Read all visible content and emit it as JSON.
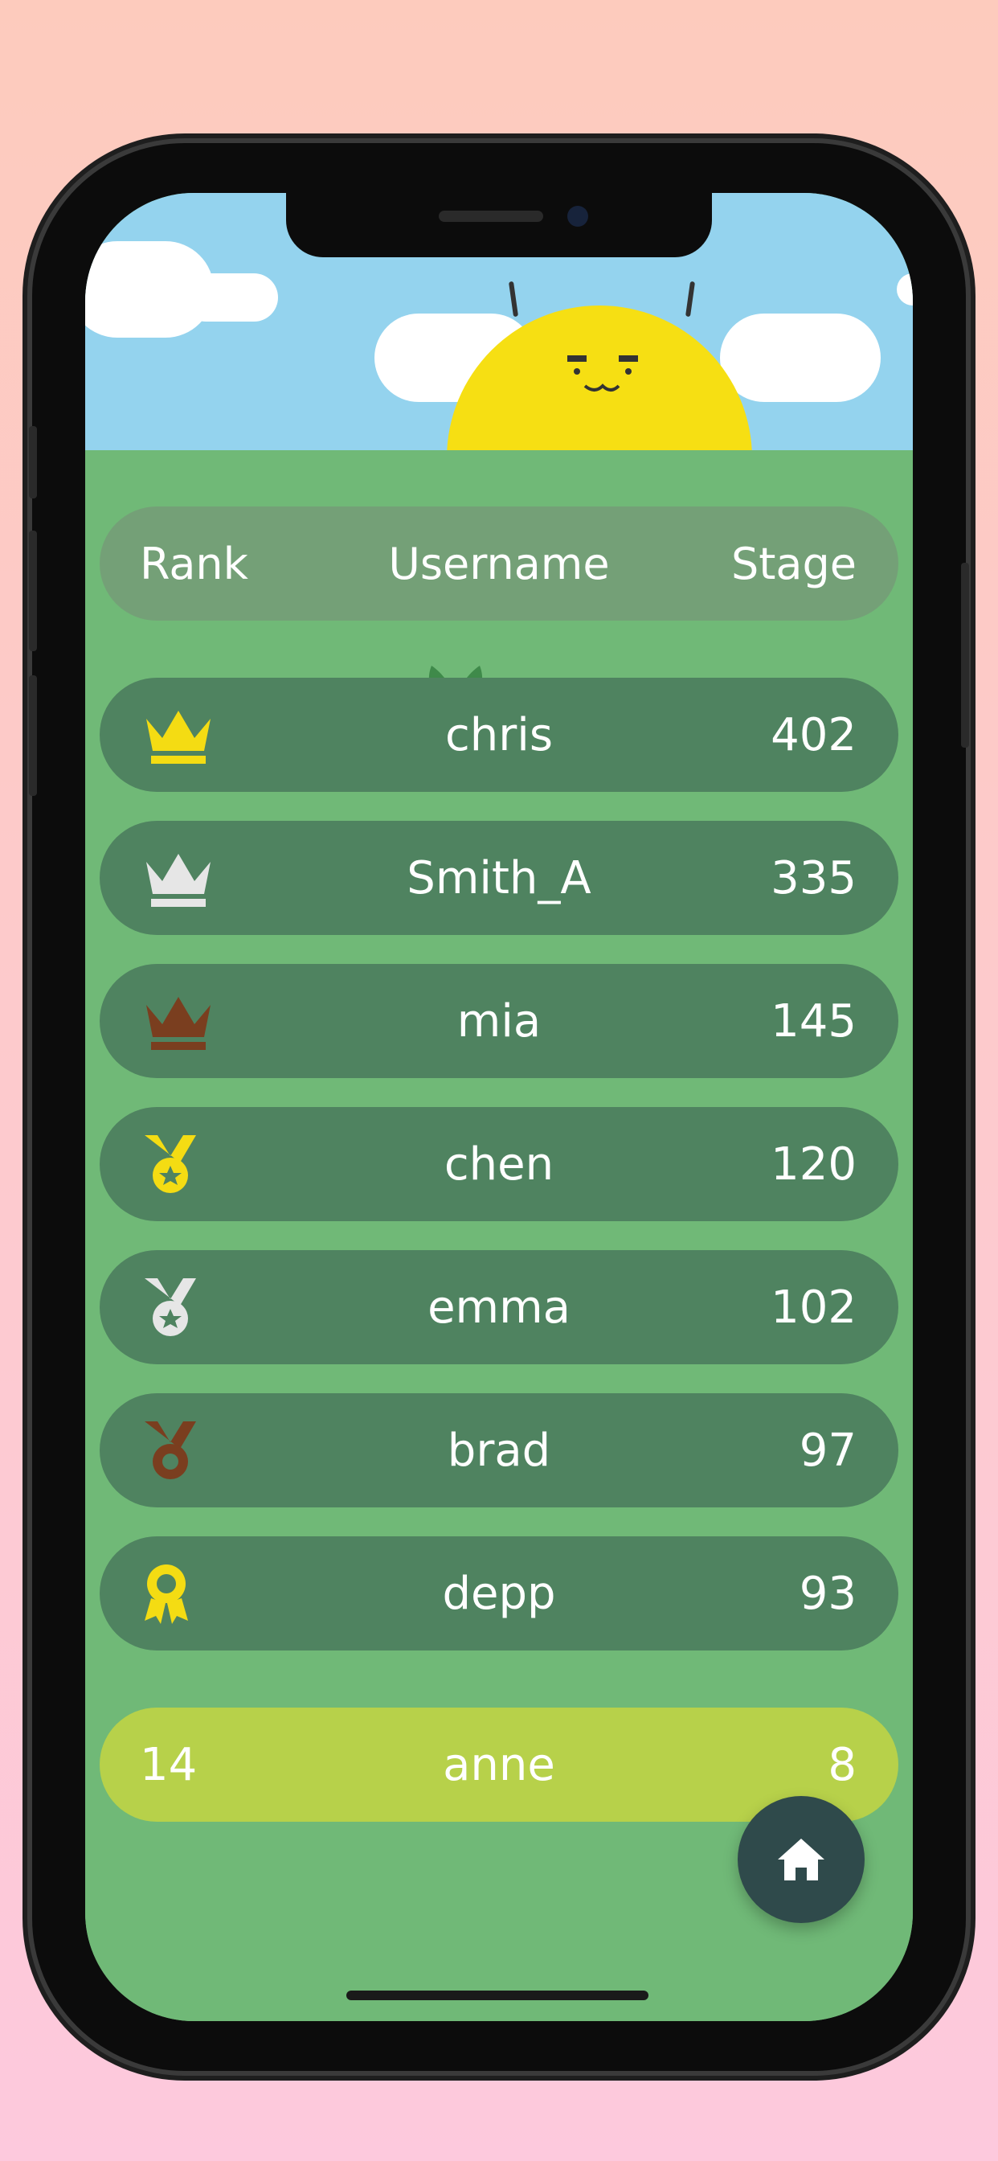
{
  "header": {
    "rank_label": "Rank",
    "username_label": "Username",
    "stage_label": "Stage"
  },
  "leaderboard": [
    {
      "rank_icon": "gold-crown-icon",
      "icon_color": "#f4dc13",
      "username": "chris",
      "stage": "402"
    },
    {
      "rank_icon": "silver-crown-icon",
      "icon_color": "#e6e6e6",
      "username": "Smith_A",
      "stage": "335"
    },
    {
      "rank_icon": "bronze-crown-icon",
      "icon_color": "#7a3e1f",
      "username": "mia",
      "stage": "145"
    },
    {
      "rank_icon": "gold-medal-icon",
      "icon_color": "#f4dc13",
      "username": "chen",
      "stage": "120"
    },
    {
      "rank_icon": "silver-medal-icon",
      "icon_color": "#e6e6e6",
      "username": "emma",
      "stage": "102"
    },
    {
      "rank_icon": "bronze-medal-icon",
      "icon_color": "#7a3e1f",
      "username": "brad",
      "stage": "97"
    },
    {
      "rank_icon": "ribbon-award-icon",
      "icon_color": "#f4dc13",
      "username": "depp",
      "stage": "93"
    }
  ],
  "current_user": {
    "rank": "14",
    "username": "anne",
    "stage": "8"
  },
  "colors": {
    "row_bg": "#4f8360",
    "self_row_bg": "#b7d14a",
    "ground": "#70b977",
    "sky": "#94d3ee",
    "home_button": "#2f4a4b"
  },
  "home_button": {
    "icon": "home-icon"
  }
}
